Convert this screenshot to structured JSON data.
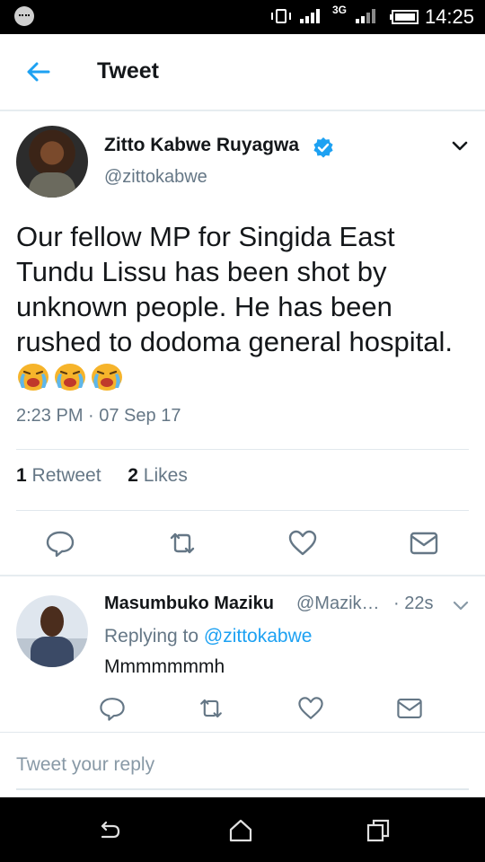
{
  "status_bar": {
    "time": "14:25",
    "network": "3G"
  },
  "app_bar": {
    "title": "Tweet"
  },
  "tweet": {
    "author_name": "Zitto Kabwe Ruyagwa",
    "author_handle": "@zittokabwe",
    "text": "Our fellow MP for Singida East Tundu Lissu has been shot by unknown people. He has been rushed to dodoma general hospital.",
    "emoji": [
      "crying-face",
      "crying-face",
      "crying-face"
    ],
    "timestamp": "2:23 PM · 07 Sep 17",
    "retweet_count": "1",
    "retweet_label": "Retweet",
    "like_count": "2",
    "like_label": "Likes"
  },
  "reply": {
    "author_name": "Masumbuko Maziku",
    "author_handle": "@Mazik…",
    "time": "· 22s",
    "replying_prefix": "Replying to",
    "replying_to": "@zittokabwe",
    "text": "Mmmmmmmh"
  },
  "compose": {
    "placeholder": "Tweet your reply"
  },
  "colors": {
    "accent": "#1da1f2",
    "muted": "#657786",
    "text": "#14171a",
    "divider": "#e1e8ed"
  },
  "icons": [
    "back-arrow-icon",
    "verified-badge-icon",
    "chevron-down-icon",
    "reply-icon",
    "retweet-icon",
    "like-icon",
    "share-mail-icon",
    "nav-back-icon",
    "nav-home-icon",
    "nav-recents-icon"
  ]
}
